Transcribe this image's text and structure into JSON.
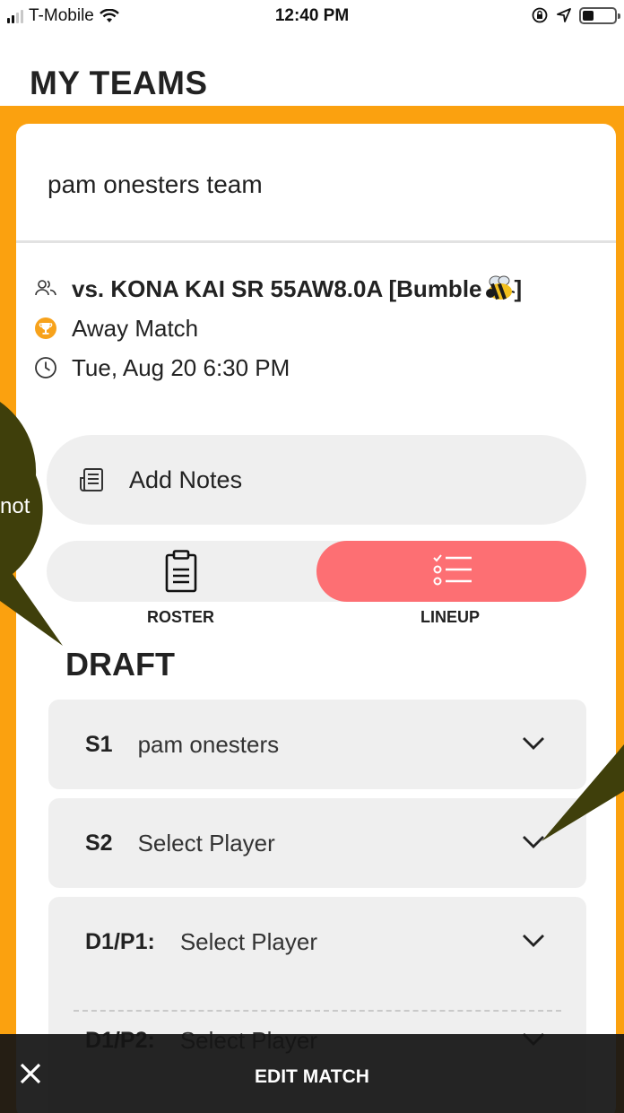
{
  "status_bar": {
    "carrier": "T-Mobile",
    "time": "12:40 PM",
    "signal_bars": 4,
    "signal_bars_active": 2,
    "battery_level": 0.35
  },
  "header": {
    "title": "MY TEAMS"
  },
  "team": {
    "name": "pam onesters team",
    "opponent": "vs. KONA KAI SR 55AW8.0A [Bumble",
    "match_type": "Away Match",
    "datetime": "Tue, Aug 20 6:30 PM"
  },
  "notes": {
    "label": "Add Notes"
  },
  "view_toggle": {
    "roster_label": "ROSTER",
    "lineup_label": "LINEUP",
    "active": "lineup"
  },
  "lineup": {
    "status": "DRAFT",
    "slots": [
      {
        "code": "S1",
        "value": "pam onesters"
      },
      {
        "code": "S2",
        "value": "Select Player"
      },
      {
        "code": "D1/P1:",
        "value": "Select Player"
      },
      {
        "code": "D1/P2:",
        "value": "Select Player"
      }
    ]
  },
  "overlay": {
    "callout_text": "not"
  },
  "bottom_bar": {
    "title": "EDIT MATCH"
  },
  "colors": {
    "frame": "#fba10f",
    "lineup_active": "#fd6f73",
    "callout": "#3f3f0b",
    "pill_bg": "#efefef"
  },
  "icons": {
    "opponent": "people-icon",
    "match_type": "trophy-icon",
    "datetime": "clock-icon",
    "notes": "notepad-icon",
    "roster": "clipboard-icon",
    "lineup": "checklist-icon",
    "slot_expand": "chevron-down-icon",
    "close": "close-icon"
  }
}
